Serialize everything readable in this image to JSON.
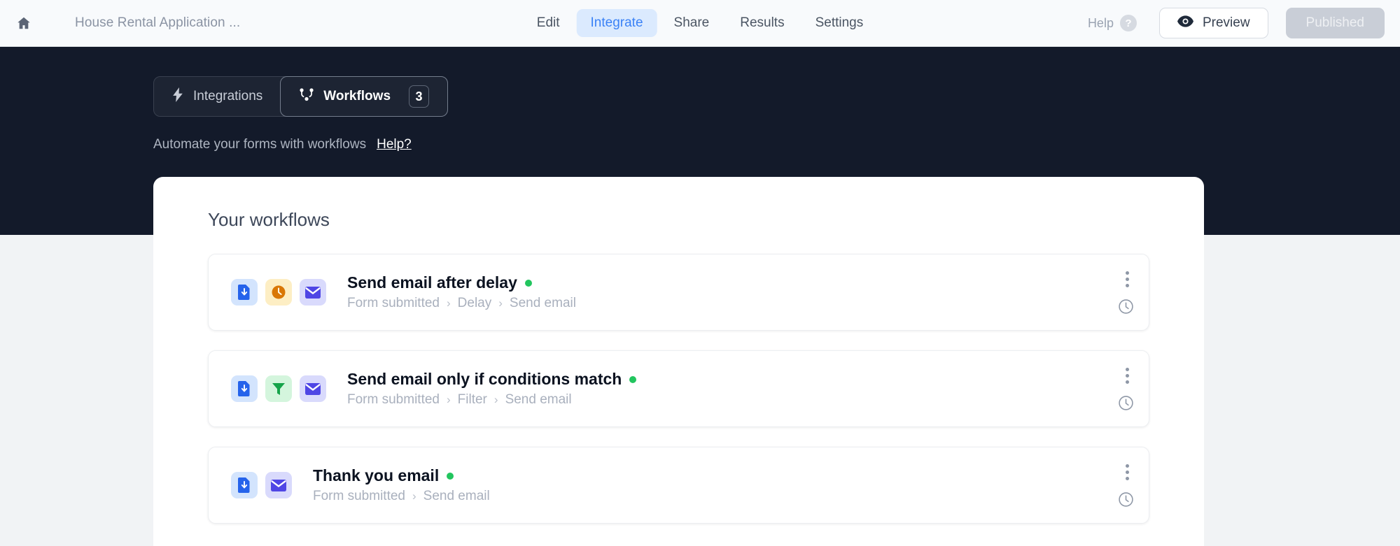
{
  "appbar": {
    "home_icon": "home-icon",
    "form_title": "House Rental Application ...",
    "tabs": [
      {
        "label": "Edit",
        "active": false
      },
      {
        "label": "Integrate",
        "active": true
      },
      {
        "label": "Share",
        "active": false
      },
      {
        "label": "Results",
        "active": false
      },
      {
        "label": "Settings",
        "active": false
      }
    ],
    "help_label": "Help",
    "help_badge": "?",
    "preview_label": "Preview",
    "preview_icon": "eye-icon",
    "published_label": "Published"
  },
  "segmented": {
    "integrations": {
      "label": "Integrations",
      "icon": "lightning-bolt-icon"
    },
    "workflows": {
      "label": "Workflows",
      "icon": "workflow-nodes-icon",
      "count": "3"
    }
  },
  "subtitle": {
    "text": "Automate your forms with workflows",
    "link": "Help?"
  },
  "panel": {
    "title": "Your workflows",
    "workflows": [
      {
        "name": "Send email after delay",
        "status_color": "#22c55e",
        "icons": [
          "form-submitted-icon",
          "delay-clock-icon",
          "send-email-icon"
        ],
        "steps": [
          "Form submitted",
          "Delay",
          "Send email"
        ],
        "menu_icon": "kebab-menu-icon",
        "history_icon": "history-clock-icon"
      },
      {
        "name": "Send email only if conditions match",
        "status_color": "#22c55e",
        "icons": [
          "form-submitted-icon",
          "filter-icon",
          "send-email-icon"
        ],
        "steps": [
          "Form submitted",
          "Filter",
          "Send email"
        ],
        "menu_icon": "kebab-menu-icon",
        "history_icon": "history-clock-icon"
      },
      {
        "name": "Thank you email",
        "status_color": "#22c55e",
        "icons": [
          "form-submitted-icon",
          "send-email-icon"
        ],
        "steps": [
          "Form submitted",
          "Send email"
        ],
        "menu_icon": "kebab-menu-icon",
        "history_icon": "history-clock-icon"
      }
    ]
  },
  "colors": {
    "accent_blue": "#3b82f6",
    "dark_band": "#131a2a",
    "page_bg": "#f1f3f5",
    "status_green": "#22c55e"
  }
}
